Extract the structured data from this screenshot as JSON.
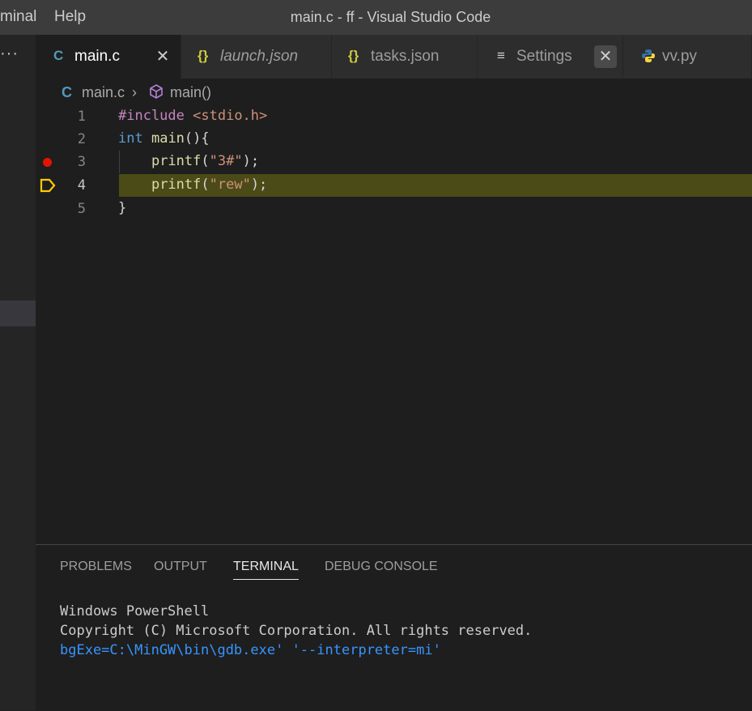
{
  "titlebar": {
    "menu": [
      "minal",
      "Help"
    ],
    "title": "main.c - ff - Visual Studio Code"
  },
  "leftbar": {
    "more": "···"
  },
  "tabs": [
    {
      "icon": "C",
      "label": "main.c",
      "close": "✕",
      "active": true
    },
    {
      "icon": "{}",
      "label": "launch.json",
      "italic": true
    },
    {
      "icon": "{}",
      "label": "tasks.json"
    },
    {
      "icon": "≡",
      "label": "Settings",
      "close": "✕"
    },
    {
      "icon": "python-icon",
      "label": "vv.py"
    }
  ],
  "breadcrumb": {
    "file_icon": "C",
    "file": "main.c",
    "sep": "›",
    "symbol": "main()"
  },
  "code": {
    "lines": [
      {
        "num": "1",
        "parts": [
          "#include",
          " ",
          "<stdio.h>"
        ]
      },
      {
        "num": "2",
        "parts": [
          "int",
          " ",
          "main",
          "(){"
        ]
      },
      {
        "num": "3",
        "parts": [
          "    ",
          "printf",
          "(",
          "\"3#\"",
          ");"
        ],
        "breakpoint": true
      },
      {
        "num": "4",
        "parts": [
          "    ",
          "printf",
          "(",
          "\"rew\"",
          ");"
        ],
        "current": true
      },
      {
        "num": "5",
        "parts": [
          "}"
        ]
      }
    ]
  },
  "panel": {
    "tabs": [
      "PROBLEMS",
      "OUTPUT",
      "TERMINAL",
      "DEBUG CONSOLE"
    ],
    "active_tab": "TERMINAL",
    "terminal": [
      "Windows PowerShell",
      "Copyright (C) Microsoft Corporation. All rights reserved.",
      "bgExe=C:\\MinGW\\bin\\gdb.exe' '--interpreter=mi'"
    ]
  },
  "colors": {
    "breakpoint": "#e51400",
    "current_line_arrow": "#ffcc00",
    "terminal_link": "#3794ff"
  }
}
